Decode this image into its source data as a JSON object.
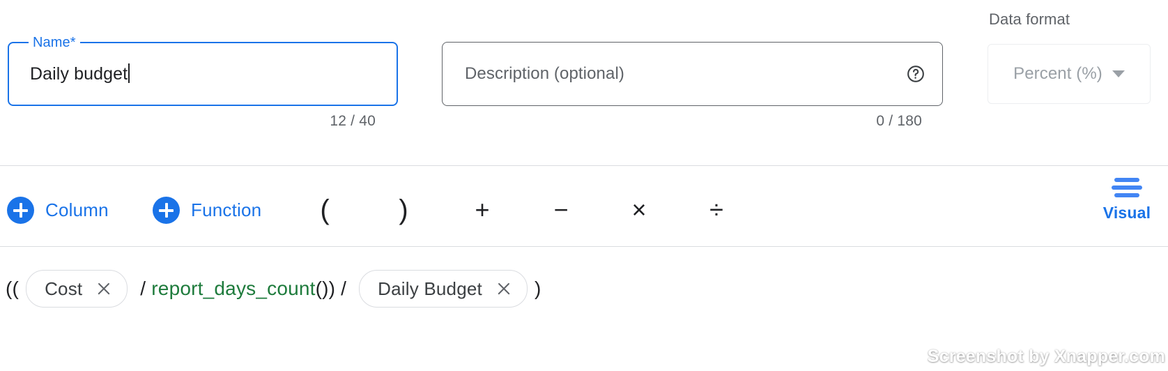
{
  "form": {
    "name_field": {
      "legend": "Name*",
      "value": "Daily budget",
      "counter": "12 / 40"
    },
    "description_field": {
      "placeholder": "Description (optional)",
      "value": "",
      "counter": "0 / 180",
      "help_icon": "help-circle-icon"
    },
    "data_format": {
      "label": "Data format",
      "value": "Percent (%)",
      "caret_icon": "chevron-down-icon"
    }
  },
  "toolbar": {
    "add_column": {
      "label": "Column",
      "icon": "plus-circle-icon"
    },
    "add_function": {
      "label": "Function",
      "icon": "plus-circle-icon"
    },
    "operators": [
      {
        "name": "paren-open",
        "symbol": "("
      },
      {
        "name": "paren-close",
        "symbol": ")"
      },
      {
        "name": "plus",
        "symbol": "+"
      },
      {
        "name": "minus",
        "symbol": "−"
      },
      {
        "name": "multiply",
        "symbol": "×"
      },
      {
        "name": "divide",
        "symbol": "÷"
      }
    ],
    "visual_toggle": {
      "label": "Visual",
      "icon": "align-center-lines-icon"
    }
  },
  "formula": {
    "tokens": [
      {
        "type": "text",
        "value": "(("
      },
      {
        "type": "chip",
        "value": "Cost",
        "remove_icon": "close-icon"
      },
      {
        "type": "text",
        "value": " / "
      },
      {
        "type": "function",
        "value": "report_days_count"
      },
      {
        "type": "text",
        "value": "()) / "
      },
      {
        "type": "chip",
        "value": "Daily Budget",
        "remove_icon": "close-icon"
      },
      {
        "type": "text",
        "value": ")"
      }
    ],
    "t0": "((",
    "chip1": "Cost",
    "t1": " / ",
    "fn": "report_days_count",
    "t2": "()) / ",
    "chip2": "Daily Budget",
    "t3": ")"
  },
  "watermark": {
    "text": "Screenshot by Xnapper.com"
  },
  "colors": {
    "accent_blue": "#1a73e8",
    "function_green": "#1e7b3c",
    "text_primary": "#202124",
    "text_secondary": "#5f6368",
    "border_grey": "#dadce0"
  }
}
